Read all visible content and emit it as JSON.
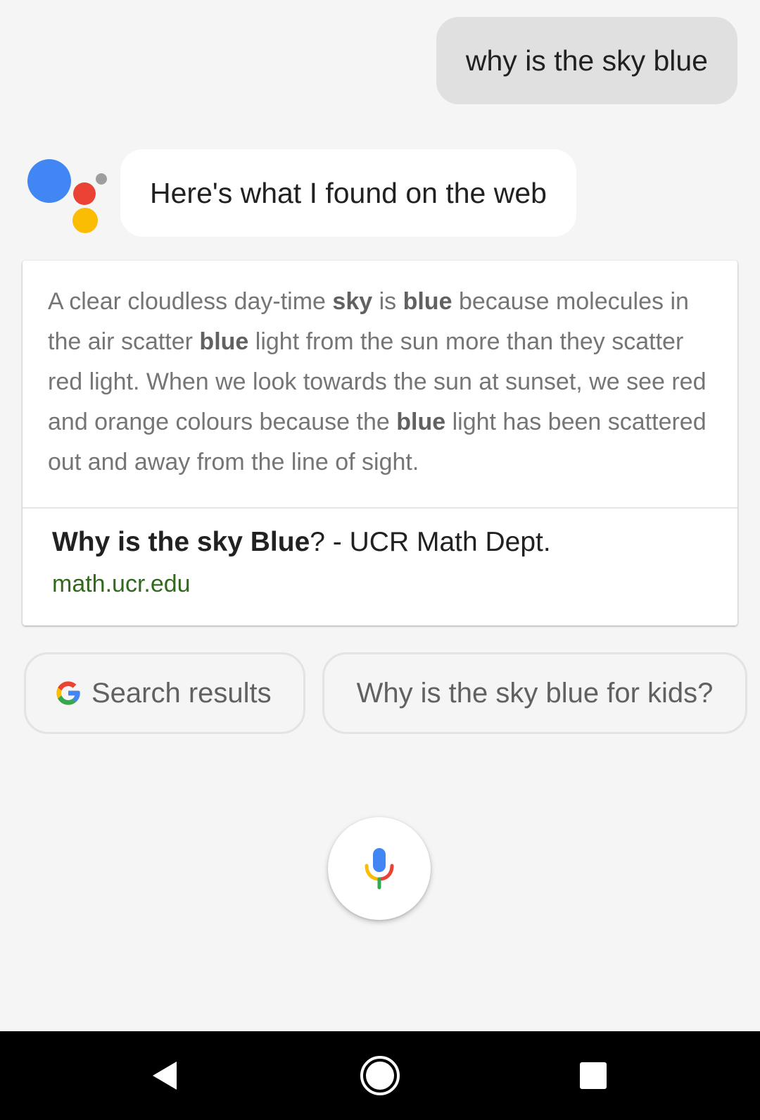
{
  "conversation": {
    "user_query": "why is the sky blue",
    "assistant_reply": "Here's what I found on the web"
  },
  "answer_card": {
    "snippet_parts": [
      {
        "text": "A clear cloudless day-time ",
        "bold": false
      },
      {
        "text": "sky",
        "bold": true
      },
      {
        "text": " is ",
        "bold": false
      },
      {
        "text": "blue",
        "bold": true
      },
      {
        "text": " because molecules in the air scatter ",
        "bold": false
      },
      {
        "text": "blue",
        "bold": true
      },
      {
        "text": " light from the sun more than they scatter red light. When we look towards the sun at sunset, we see red and orange colours because the ",
        "bold": false
      },
      {
        "text": "blue",
        "bold": true
      },
      {
        "text": " light has been scattered out and away from the line of sight.",
        "bold": false
      }
    ],
    "source_title_bold": "Why is the sky Blue",
    "source_title_rest": "? - UCR Math Dept.",
    "source_url": "math.ucr.edu"
  },
  "suggestions": {
    "search_results_label": "Search results",
    "follow_up_label": "Why is the sky blue for kids?"
  },
  "icons": {
    "assistant_logo": "google-assistant-logo",
    "google": "google-g-icon",
    "mic": "microphone-icon",
    "nav_back": "back-triangle-icon",
    "nav_home": "home-circle-icon",
    "nav_recents": "recents-square-icon"
  },
  "colors": {
    "google_blue": "#4285F4",
    "google_red": "#EA4335",
    "google_yellow": "#FBBC04",
    "google_green": "#34A853",
    "assistant_gray": "#9E9E9E",
    "url_green": "#33691E"
  }
}
